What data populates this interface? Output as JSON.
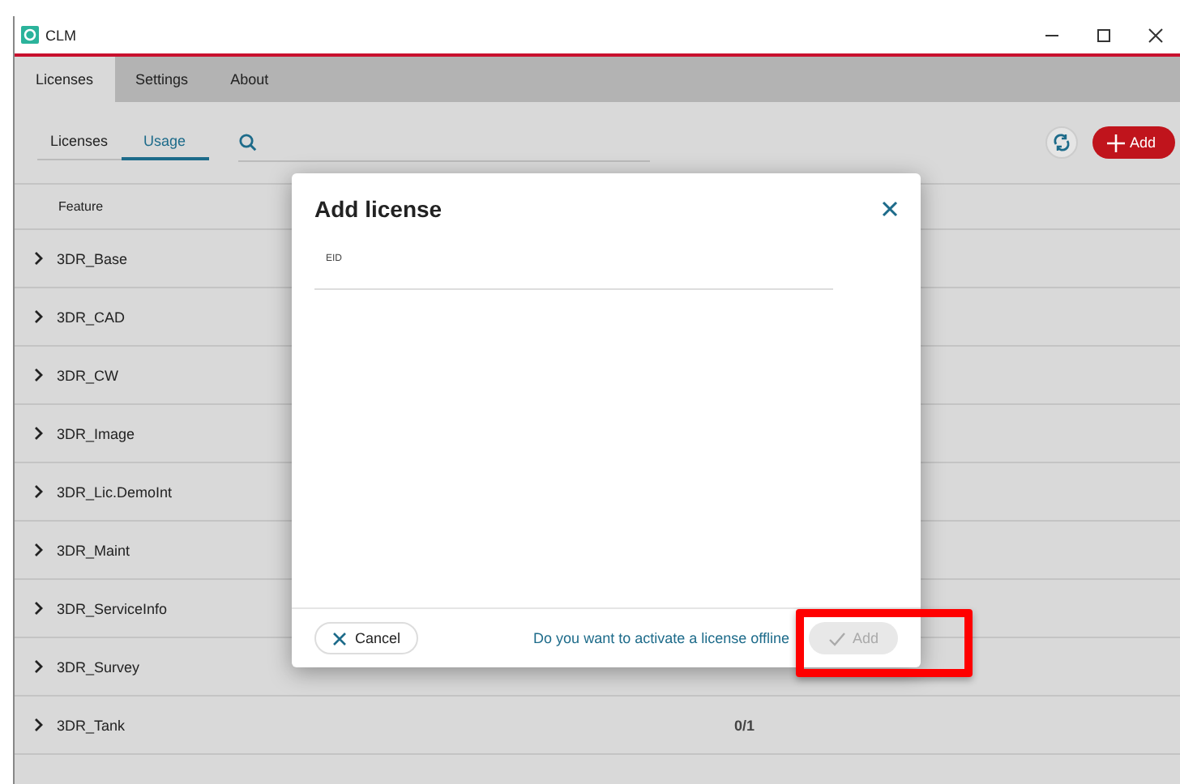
{
  "window": {
    "title": "CLM"
  },
  "tabs": [
    {
      "label": "Licenses",
      "selected": true
    },
    {
      "label": "Settings",
      "selected": false
    },
    {
      "label": "About",
      "selected": false
    }
  ],
  "subtabs": [
    {
      "label": "Licenses",
      "selected": false
    },
    {
      "label": "Usage",
      "selected": true
    }
  ],
  "toolbar": {
    "add_button": "Add"
  },
  "table": {
    "columns": [
      "Feature"
    ],
    "rows": [
      {
        "feature": "3DR_Base",
        "usage": ""
      },
      {
        "feature": "3DR_CAD",
        "usage": ""
      },
      {
        "feature": "3DR_CW",
        "usage": ""
      },
      {
        "feature": "3DR_Image",
        "usage": ""
      },
      {
        "feature": "3DR_Lic.DemoInt",
        "usage": ""
      },
      {
        "feature": "3DR_Maint",
        "usage": ""
      },
      {
        "feature": "3DR_ServiceInfo",
        "usage": ""
      },
      {
        "feature": "3DR_Survey",
        "usage": ""
      },
      {
        "feature": "3DR_Tank",
        "usage": "0/1"
      }
    ]
  },
  "dialog": {
    "title": "Add license",
    "field_label": "EID",
    "cancel": "Cancel",
    "offline_link": "Do you want to activate a license offline",
    "add": {
      "label": "Add",
      "disabled": true,
      "highlighted": true
    }
  }
}
